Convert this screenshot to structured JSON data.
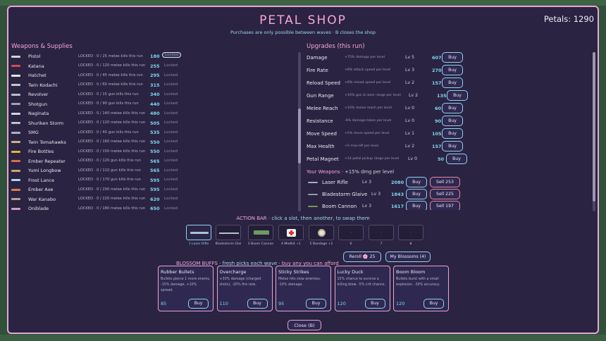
{
  "header": {
    "title": "PETAL SHOP",
    "petals": "Petals: 1290",
    "subtitle": "Purchases are only possible between waves · B closes the shop"
  },
  "weapons": {
    "heading": "Weapons & Supplies",
    "items": [
      {
        "name": "Pistol",
        "req": "LOCKED · 0 / 25 melee kills this run",
        "cost": "180",
        "status": "Locked",
        "selected": true
      },
      {
        "name": "Katana",
        "req": "LOCKED · 0 / 120 melee kills this run",
        "cost": "255",
        "status": "Locked"
      },
      {
        "name": "Hatchet",
        "req": "LOCKED · 0 / 45 melee kills this run",
        "cost": "295",
        "status": "Locked"
      },
      {
        "name": "Twin Kodachi",
        "req": "LOCKED · 0 / 60 melee kills this run",
        "cost": "315",
        "status": "Locked"
      },
      {
        "name": "Revolver",
        "req": "LOCKED · 0 / 15 gun kills this run",
        "cost": "340",
        "status": "Locked"
      },
      {
        "name": "Shotgun",
        "req": "LOCKED · 0 / 90 gun kills this run",
        "cost": "440",
        "status": "Locked"
      },
      {
        "name": "Naginata",
        "req": "LOCKED · 0 / 140 melee kills this run",
        "cost": "480",
        "status": "Locked"
      },
      {
        "name": "Shuriken Storm",
        "req": "LOCKED · 0 / 120 melee kills this run",
        "cost": "505",
        "status": "Locked"
      },
      {
        "name": "SMG",
        "req": "LOCKED · 0 / 40 gun kills this run",
        "cost": "535",
        "status": "Locked"
      },
      {
        "name": "Twin Tomahawks",
        "req": "LOCKED · 0 / 160 melee kills this run",
        "cost": "550",
        "status": "Locked"
      },
      {
        "name": "Fire Bottles",
        "req": "LOCKED · 0 / 150 melee kills this run",
        "cost": "550",
        "status": "Locked"
      },
      {
        "name": "Ember Repeater",
        "req": "LOCKED · 0 / 120 gun kills this run",
        "cost": "565",
        "status": "Locked"
      },
      {
        "name": "Yumi Longbow",
        "req": "LOCKED · 0 / 110 gun kills this run",
        "cost": "565",
        "status": "Locked"
      },
      {
        "name": "Frost Lance",
        "req": "LOCKED · 0 / 170 gun kills this run",
        "cost": "595",
        "status": "Locked"
      },
      {
        "name": "Ember Axe",
        "req": "LOCKED · 0 / 200 melee kills this run",
        "cost": "595",
        "status": "Locked"
      },
      {
        "name": "War Kanabo",
        "req": "LOCKED · 0 / 220 melee kills this run",
        "cost": "620",
        "status": "Locked"
      },
      {
        "name": "Oniblade",
        "req": "LOCKED · 0 / 180 melee kills this run",
        "cost": "650",
        "status": "Locked"
      }
    ]
  },
  "upgrades": {
    "heading": "Upgrades (this run)",
    "items": [
      {
        "name": "Damage",
        "desc": "+75% damage per level",
        "level": "Lv 5",
        "cost": "607",
        "button": "Buy"
      },
      {
        "name": "Fire Rate",
        "desc": "+8% attack speed per level",
        "level": "Lv 3",
        "cost": "270",
        "button": "Buy"
      },
      {
        "name": "Reload Speed",
        "desc": "+8% reload speed per level",
        "level": "Lv 2",
        "cost": "157",
        "button": "Buy"
      },
      {
        "name": "Gun Range",
        "desc": "+10% gun & laser range per level",
        "level": "Lv 2",
        "cost": "135",
        "button": "Buy"
      },
      {
        "name": "Melee Reach",
        "desc": "+10% melee reach per level",
        "level": "Lv 0",
        "cost": "60",
        "button": "Buy"
      },
      {
        "name": "Resistance",
        "desc": "-6% damage taken per level",
        "level": "Lv 0",
        "cost": "90",
        "button": "Buy"
      },
      {
        "name": "Move Speed",
        "desc": "+5% move speed per level",
        "level": "Lv 1",
        "cost": "105",
        "button": "Buy"
      },
      {
        "name": "Max Health",
        "desc": "+5 max HP per level",
        "level": "Lv 2",
        "cost": "157",
        "button": "Buy"
      },
      {
        "name": "Petal Magnet",
        "desc": "+14 petal pickup range per level",
        "level": "Lv 0",
        "cost": "50",
        "button": "Buy"
      }
    ],
    "your_weapons": {
      "heading": "Your Weapons",
      "bonus": "+15% dmg per level",
      "items": [
        {
          "name": "Laser Rifle",
          "level": "Lv 3",
          "cost": "2080",
          "buy": "Buy",
          "sell": "Sell  253"
        },
        {
          "name": "Bladestorm Glaive",
          "level": "Lv 3",
          "cost": "1843",
          "buy": "Buy",
          "sell": "Sell  225"
        },
        {
          "name": "Boom Cannon",
          "level": "Lv 3",
          "cost": "1617",
          "buy": "Buy",
          "sell": "Sell  197"
        }
      ]
    }
  },
  "action_bar": {
    "heading": "ACTION BAR",
    "hint": "click a slot, then another, to swap them",
    "slots": [
      {
        "label": "1  Laser Rifle",
        "icon": "laser-rifle-icon",
        "active": true
      },
      {
        "label": "Bladestorm Glai",
        "icon": "glaive-icon"
      },
      {
        "label": "3  Boom Cannon",
        "icon": "cannon-icon"
      },
      {
        "label": "4  Medkit +1",
        "icon": "medkit-icon"
      },
      {
        "label": "5  Bandage +1",
        "icon": "bandage-icon"
      },
      {
        "label": "6",
        "empty": "-"
      },
      {
        "label": "7",
        "empty": "-"
      },
      {
        "label": "8",
        "empty": "-"
      }
    ]
  },
  "blossom": {
    "heading": "BLOSSOM BUFFS",
    "sub1": "fresh picks each wave",
    "sub2": "buy any you can afford",
    "reroll": "Reroll  🌸 25",
    "my_blossoms": "My Blossoms (4)",
    "cards": [
      {
        "name": "Rubber Bullets",
        "desc": "Bullets pierce 1 more enemy. -15% damage, +10% spread.",
        "cost": "85",
        "button": "Buy"
      },
      {
        "name": "Overcharge",
        "desc": "+30% damage (charged shots), -20% fire rate.",
        "cost": "110",
        "button": "Buy"
      },
      {
        "name": "Sticky Strikes",
        "desc": "Melee hits slow enemies. -10% damage.",
        "cost": "95",
        "button": "Buy"
      },
      {
        "name": "Lucky Duck",
        "desc": "15% chance to survive a killing blow. -5% crit chance.",
        "cost": "120",
        "button": "Buy"
      },
      {
        "name": "Boom Bloom",
        "desc": "Bullets burst with a small explosion. -30% accuracy.",
        "cost": "120",
        "button": "Buy"
      }
    ]
  },
  "footer": {
    "close": "Close  (B)"
  },
  "colors": {
    "accent_pink": "#f6a6d8",
    "accent_blue": "#8fd4ef",
    "panel": "#2a2341"
  }
}
